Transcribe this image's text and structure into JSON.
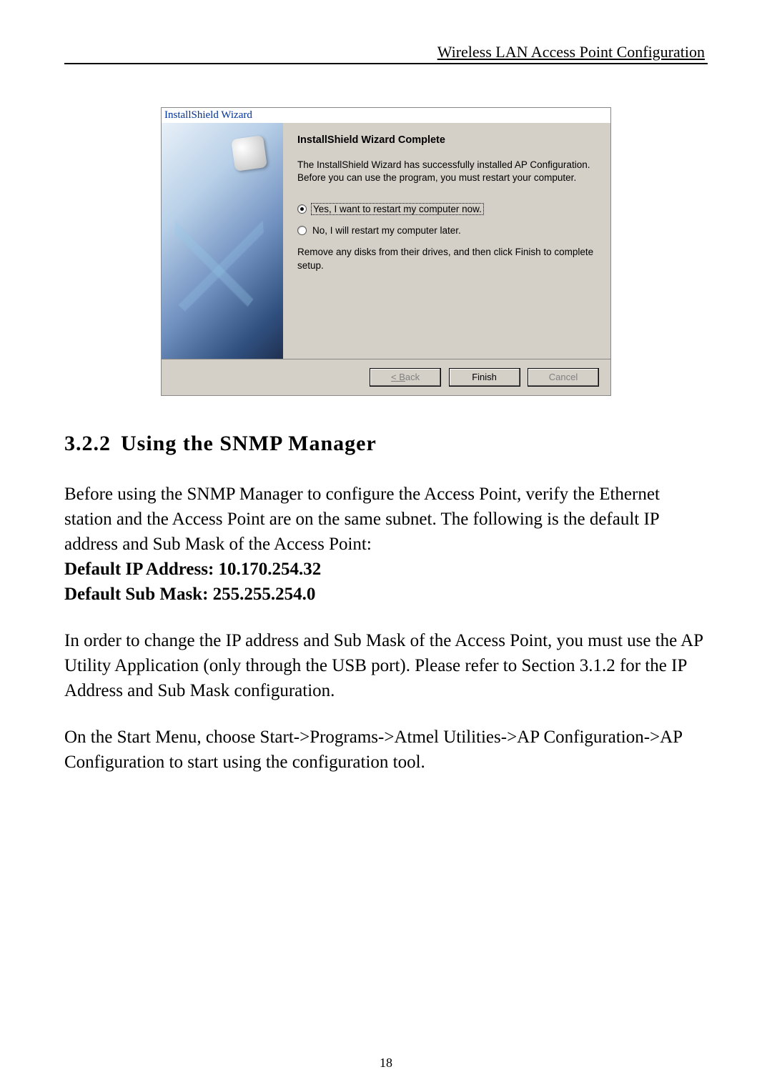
{
  "header": {
    "title": "Wireless LAN Access Point Configuration"
  },
  "dialog": {
    "title": "InstallShield Wizard",
    "heading": "InstallShield Wizard Complete",
    "description": "The InstallShield Wizard has successfully installed AP Configuration.  Before you can use the program, you must restart your computer.",
    "radio_yes": "Yes, I want to restart my computer now.",
    "radio_no": "No, I will restart my computer later.",
    "remove_text": "Remove any disks from their drives, and then click Finish to complete setup.",
    "back_btn": "< Back",
    "finish_btn": "Finish",
    "cancel_btn": "Cancel"
  },
  "section": {
    "number": "3.2.2",
    "title": "Using the SNMP Manager"
  },
  "paragraphs": {
    "p1": "Before using the SNMP Manager to configure the Access Point, verify the Ethernet station and the Access Point are on the same subnet. The following is the default IP address and Sub Mask of the Access Point:",
    "default_ip_label": "Default IP Address: 10.170.254.32",
    "default_mask_label": "Default Sub Mask:  255.255.254.0",
    "p2": "In order to change the IP address and Sub Mask of the Access Point, you must use the AP Utility Application (only through the USB port). Please refer to Section 3.1.2 for the IP Address and Sub Mask configuration.",
    "p3": "On the Start Menu, choose Start->Programs->Atmel Utilities->AP Configuration->AP Configuration to start using the configuration tool."
  },
  "page_number": "18"
}
